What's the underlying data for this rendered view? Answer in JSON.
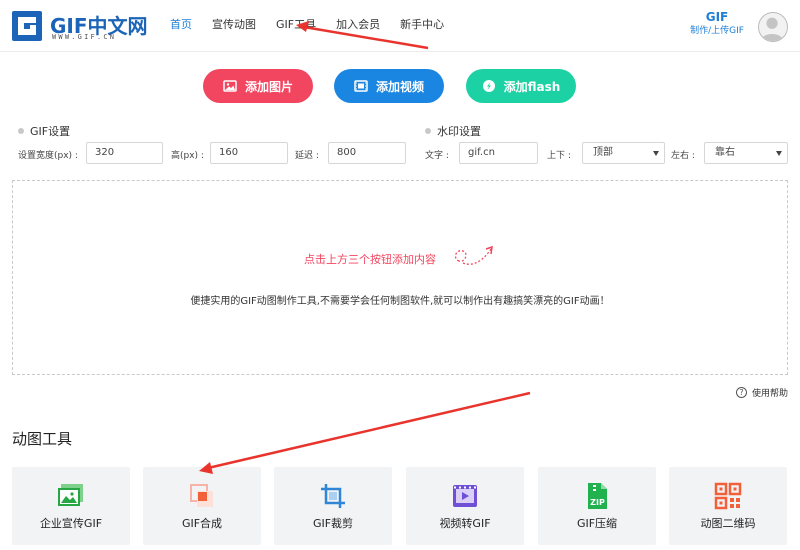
{
  "header": {
    "logo_text": "GIF中文网",
    "logo_sub": "WWW.GIF.CN",
    "nav": [
      "首页",
      "宣传动图",
      "GIF工具",
      "加入会员",
      "新手中心"
    ],
    "active_nav": "首页",
    "brand_big": "GIF",
    "brand_small": "制作/上传GIF",
    "avatar_icon": "user-avatar-icon"
  },
  "actions": {
    "add_image": "添加图片",
    "add_video": "添加视频",
    "add_flash": "添加flash"
  },
  "gif_settings": {
    "title": "GIF设置",
    "width_label": "设置宽度(px) :",
    "width_value": "320",
    "height_label": "高(px) :",
    "height_value": "160",
    "delay_label": "延迟 :",
    "delay_value": "800"
  },
  "watermark": {
    "title": "水印设置",
    "text_label": "文字 :",
    "text_value": "gif.cn",
    "vertical_label": "上下 :",
    "vertical_value": "顶部",
    "horizontal_label": "左右 :",
    "horizontal_value": "靠右"
  },
  "dropzone": {
    "hint": "点击上方三个按钮添加内容",
    "description": "便捷实用的GIF动图制作工具,不需要学会任何制图软件,就可以制作出有趣搞笑漂亮的GIF动画！"
  },
  "help": {
    "label": "使用帮助"
  },
  "tools": {
    "title": "动图工具",
    "items": [
      {
        "label": "企业宣传GIF",
        "icon": "image-icon"
      },
      {
        "label": "GIF合成",
        "icon": "merge-icon"
      },
      {
        "label": "GIF裁剪",
        "icon": "crop-icon"
      },
      {
        "label": "视频转GIF",
        "icon": "video-icon"
      },
      {
        "label": "GIF压缩",
        "icon": "zip-icon"
      },
      {
        "label": "动图二维码",
        "icon": "qrcode-icon"
      }
    ]
  },
  "colors": {
    "brand_blue": "#1e7fd6",
    "red": "#f2455f",
    "blue": "#1b86e2",
    "teal": "#1cd1a3"
  }
}
